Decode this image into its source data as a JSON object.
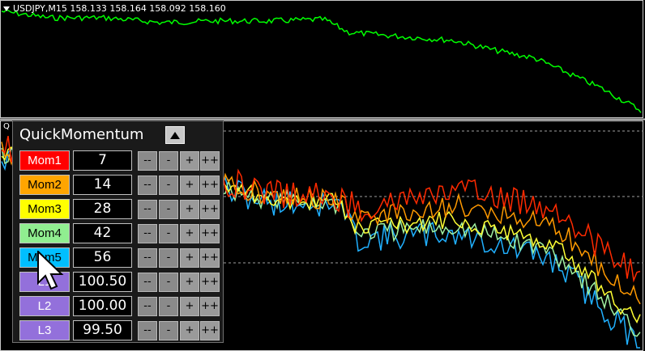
{
  "window": {
    "symbol_info": "USDJPY,M15  158.133 158.164 158.092 158.160",
    "sub_window_label": "Q"
  },
  "panel": {
    "title": "QuickMomentum",
    "rows": [
      {
        "label": "Mom1",
        "value": "7",
        "bg": "#ff0000",
        "fg": "#ffffff"
      },
      {
        "label": "Mom2",
        "value": "14",
        "bg": "#ffa500",
        "fg": "#000000"
      },
      {
        "label": "Mom3",
        "value": "28",
        "bg": "#ffff00",
        "fg": "#000000"
      },
      {
        "label": "Mom4",
        "value": "42",
        "bg": "#90ee90",
        "fg": "#000000"
      },
      {
        "label": "Mom5",
        "value": "56",
        "bg": "#00bfff",
        "fg": "#000000"
      },
      {
        "label": "L1",
        "value": "100.50",
        "bg": "#9370db",
        "fg": "#ffffff"
      },
      {
        "label": "L2",
        "value": "100.00",
        "bg": "#9370db",
        "fg": "#ffffff"
      },
      {
        "label": "L3",
        "value": "99.50",
        "bg": "#9370db",
        "fg": "#ffffff"
      }
    ],
    "step_buttons": [
      "--",
      "-",
      "+",
      "++"
    ]
  },
  "colors": {
    "price": "#00ff00",
    "mom1": "#ff2a00",
    "mom2": "#ff9900",
    "mom3": "#ffff33",
    "mom4": "#a0f0a0",
    "mom5": "#20b0ff",
    "level_line": "#a0a0a0"
  },
  "icons": {
    "collapse": "triangle-up-icon",
    "cursor": "mouse-pointer-icon"
  }
}
